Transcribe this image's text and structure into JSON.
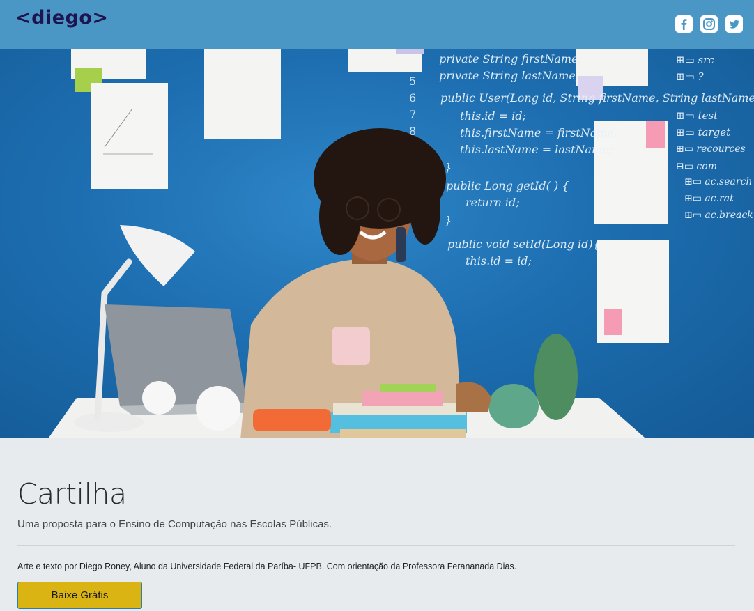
{
  "header": {
    "logo": "<diego>",
    "social": [
      {
        "icon": "facebook-icon"
      },
      {
        "icon": "instagram-icon"
      },
      {
        "icon": "twitter-icon"
      }
    ]
  },
  "hero": {
    "code_lines": [
      "private String firstName;",
      "private String lastName;",
      "public User(Long id, String firstName, String lastName){",
      "this.id = id;",
      "this.firstName = firstName;",
      "this.lastName = lastName;",
      "}",
      "public Long getId( ) {",
      "return id;",
      "}",
      "public void setId(Long id){",
      "this.id = id;"
    ],
    "line_numbers": [
      "5",
      "6",
      "7",
      "8"
    ],
    "tree": [
      "src",
      "?",
      "test",
      "target",
      "recources",
      "com",
      "ac.search",
      "ac.rat",
      "ac.breack"
    ]
  },
  "content": {
    "title": "Cartilha",
    "subtitle": "Uma proposta para o Ensino de Computação nas Escolas Públicas.",
    "credits": "Arte e texto por Diego Roney, Aluno da Universidade Federal da Paríba- UFPB. Com orientação da Professora Ferananada Dias.",
    "cta_label": "Baixe Grátis"
  },
  "colors": {
    "header_bg": "#4a97c6",
    "logo": "#1e1450",
    "page_bg": "#e8ebee",
    "cta_bg": "#d9b413",
    "cta_border": "#2a7fae"
  }
}
